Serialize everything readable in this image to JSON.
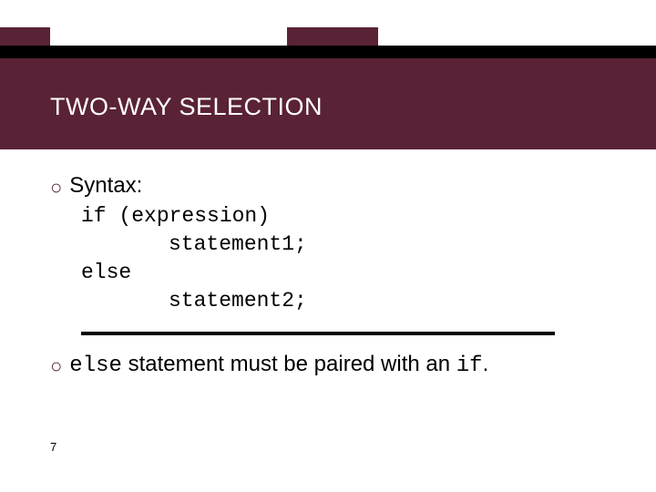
{
  "title": "TWO-WAY SELECTION",
  "bullets": {
    "syntax_label": "Syntax:",
    "code": {
      "line1": "if (expression)",
      "line2": "statement1;",
      "line3": "else",
      "line4": "statement2;"
    },
    "note": {
      "kw1": "else",
      "mid": " statement must be paired with an ",
      "kw2": "if",
      "tail": "."
    }
  },
  "page_number": "7",
  "colors": {
    "accent": "#5a2236"
  },
  "icons": {
    "bullet_glyph": "○"
  }
}
